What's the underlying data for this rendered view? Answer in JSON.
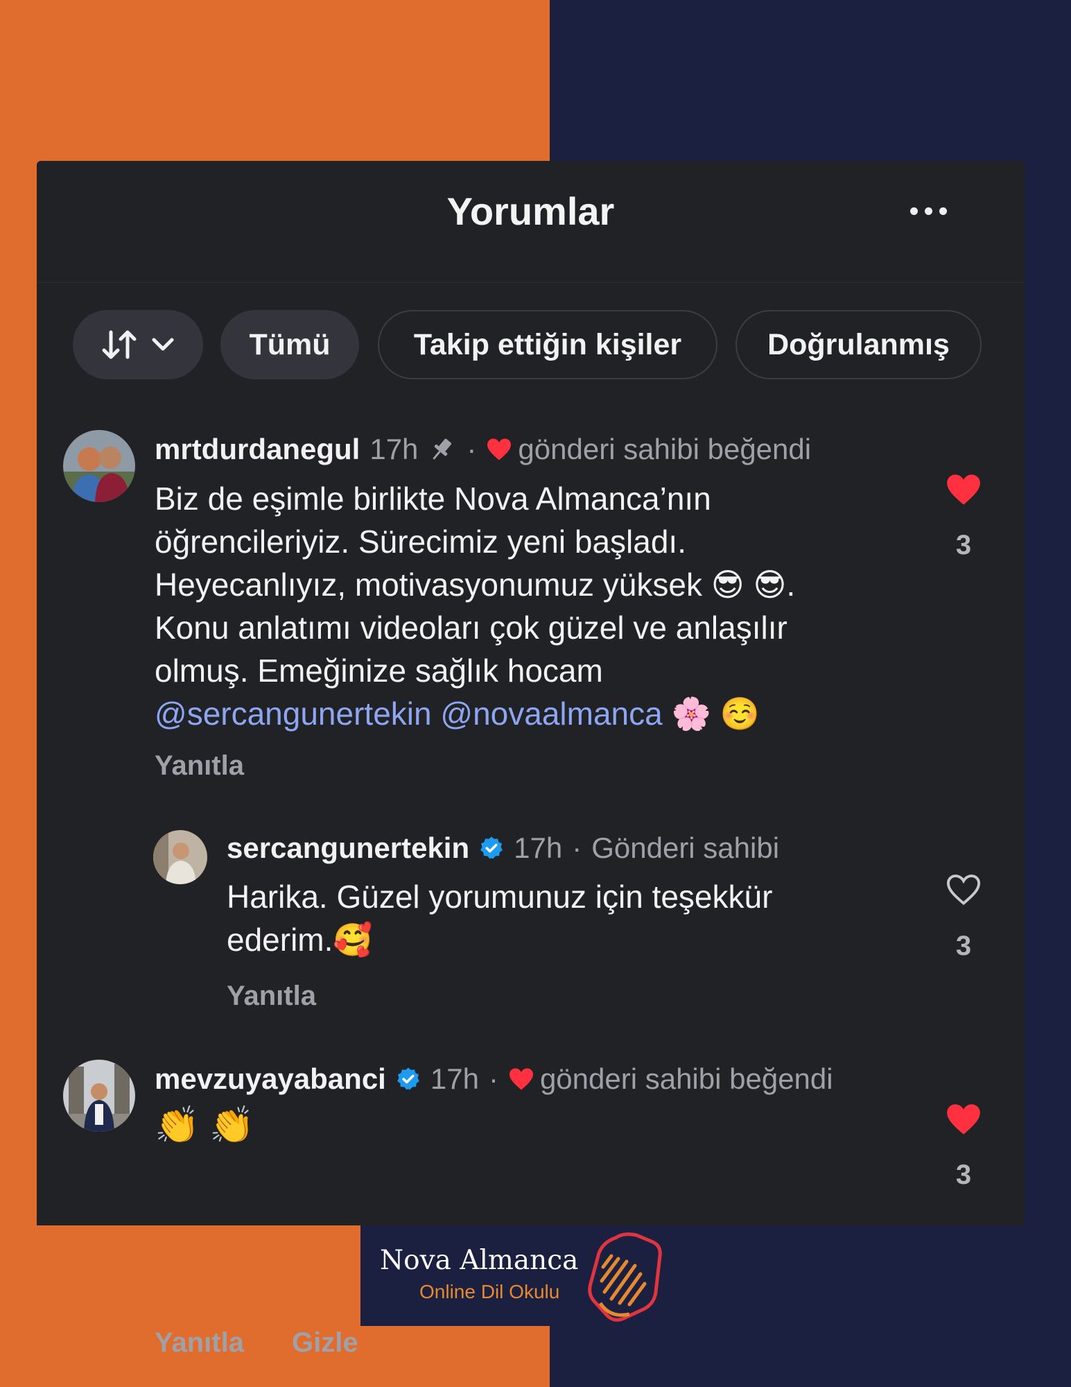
{
  "header": {
    "title": "Yorumlar"
  },
  "filters": {
    "all": "Tümü",
    "following": "Takip ettiğin kişiler",
    "verified": "Doğrulanmış"
  },
  "comments": [
    {
      "username": "mrtdurdanegul",
      "time": "17h",
      "separator": "·",
      "liked_by_author": "gönderi sahibi beğendi",
      "text_lines": [
        "Biz de eşimle birlikte Nova Almanca’nın",
        "öğrencileriyiz.  Sürecimiz yeni başladı.",
        "Heyecanlıyız, motivasyonumuz yüksek 😎 😎.",
        "Konu anlatımı videoları çok güzel ve anlaşılır",
        "olmuş. Emeğinize sağlık hocam"
      ],
      "mentions": [
        "@sercangunertekin",
        "@novaalmanca"
      ],
      "mention_emoji": "🌸 ☺️",
      "reply_label": "Yanıtla",
      "like_count": "3",
      "liked": true
    },
    {
      "username": "sercangunertekin",
      "time": "17h",
      "separator": "·",
      "role": "Gönderi sahibi",
      "text_lines": [
        "Harika. Güzel yorumunuz için teşekkür",
        "ederim.🥰"
      ],
      "reply_label": "Yanıtla",
      "like_count": "3",
      "liked": false
    },
    {
      "username": "mevzuyayabanci",
      "time": "17h",
      "separator": "·",
      "liked_by_author": "gönderi sahibi beğendi",
      "text_lines": [
        "👏 👏"
      ],
      "reply_label": "Yanıtla",
      "hide_label": "Gizle",
      "like_count": "3",
      "liked": true
    }
  ],
  "brand": {
    "name": "Nova Almanca",
    "tagline": "Online Dil Okulu"
  },
  "colors": {
    "orange": "#e06c2e",
    "navy": "#1b2040",
    "panel": "#212226",
    "like_red": "#ff3040",
    "mention_blue": "#8ea5f2",
    "verified_blue": "#1d9bf0"
  }
}
